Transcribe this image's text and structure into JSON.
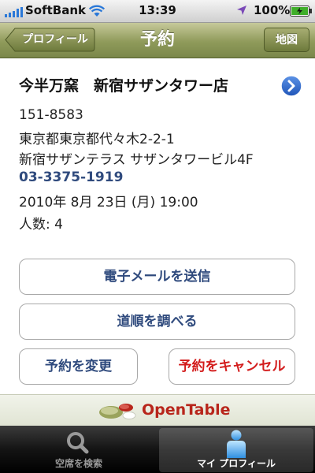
{
  "status_bar": {
    "carrier": "SoftBank",
    "time": "13:39",
    "battery": "100%"
  },
  "nav": {
    "back_label": "プロフィール",
    "title": "予約",
    "map_label": "地図"
  },
  "reservation": {
    "restaurant": "今半万窯　新宿サザンタワー店",
    "postal_code": "151-8583",
    "address_line1": "東京都東京都代々木2-2-1",
    "address_line2": "新宿サザンテラス サザンタワービル4F",
    "phone": "03-3375-1919",
    "datetime": "2010年 8月 23日 (月) 19:00",
    "party_size": "人数: 4"
  },
  "actions": {
    "email_label": "電子メールを送信",
    "directions_label": "道順を調べる",
    "change_label": "予約を変更",
    "cancel_label": "予約をキャンセル"
  },
  "footer": {
    "brand": "OpenTable"
  },
  "tabs": [
    {
      "label": "空席を検索",
      "icon": "search-icon",
      "selected": false
    },
    {
      "label": "マイ プロフィール",
      "icon": "person-icon",
      "selected": true
    }
  ],
  "colors": {
    "nav": "#8f9a5a",
    "link_blue": "#2f4a7d",
    "cancel_red": "#d31c1c",
    "brand_red": "#b8251b"
  }
}
